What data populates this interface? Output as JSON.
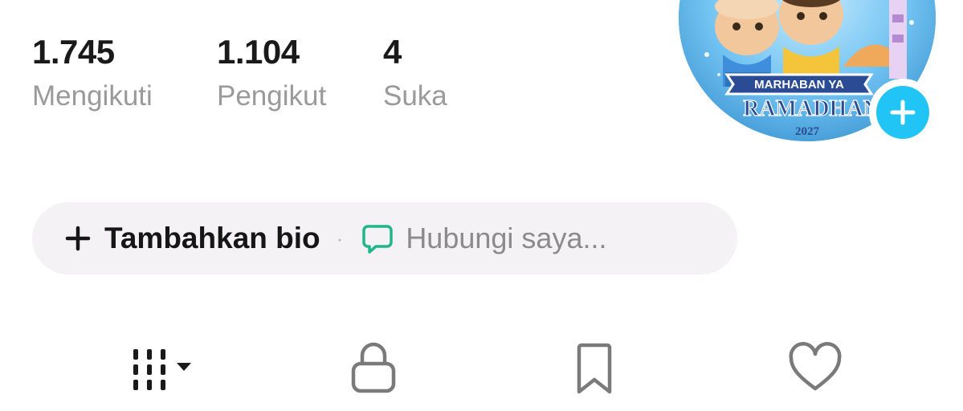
{
  "profile": {
    "stats": [
      {
        "value": "1.745",
        "label": "Mengikuti"
      },
      {
        "value": "1.104",
        "label": "Pengikut"
      },
      {
        "value": "4",
        "label": "Suka"
      }
    ],
    "avatar": {
      "line1": "MARHABAN YA",
      "line2": "RAMADHAN",
      "line3": "2027"
    }
  },
  "bio": {
    "add_bio_label": "Tambahkan bio",
    "separator": "·",
    "contact_label": "Hubungi saya..."
  },
  "icons": {
    "add_bio": "plus-icon",
    "contact": "chat-bubble-icon",
    "add_avatar": "plus-icon",
    "tabs": [
      "grid-icon",
      "lock-icon",
      "bookmark-icon",
      "heart-icon"
    ]
  },
  "colors": {
    "accent": "#20c5f5",
    "contact_icon": "#21b58a",
    "text_primary": "#1a1a1a",
    "text_secondary": "#9a9a9a",
    "pill_bg": "#f4f2f5"
  }
}
